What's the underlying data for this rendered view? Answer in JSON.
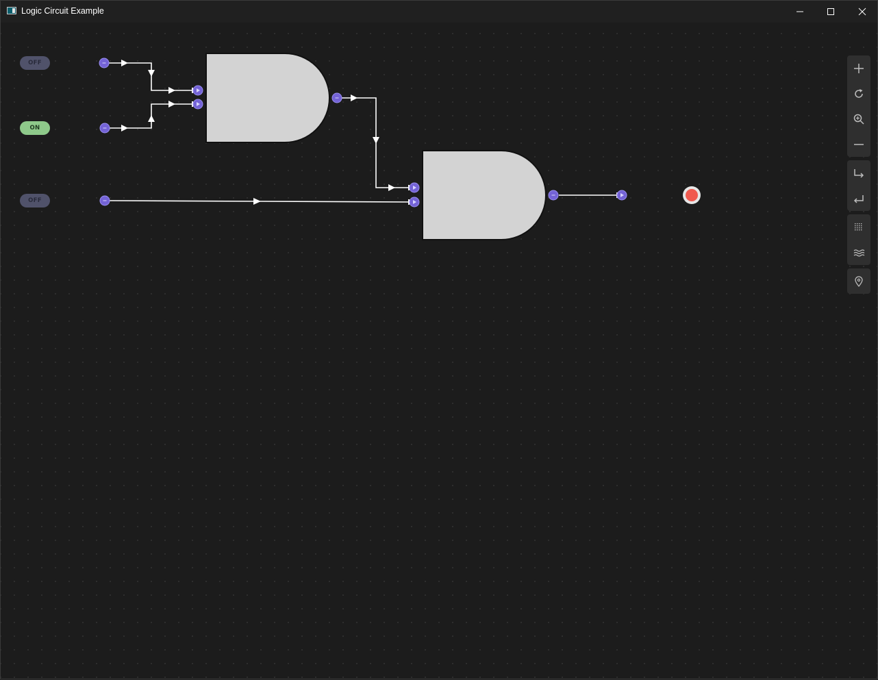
{
  "window": {
    "title": "Logic Circuit Example",
    "icons": [
      "app-icon",
      "minimize-icon",
      "maximize-icon",
      "close-icon"
    ]
  },
  "inputs": [
    {
      "label": "OFF",
      "state": "off"
    },
    {
      "label": "ON",
      "state": "on"
    },
    {
      "label": "OFF",
      "state": "off"
    }
  ],
  "gates": [
    {
      "type": "AND",
      "inputs": 2
    },
    {
      "type": "AND",
      "inputs": 2
    }
  ],
  "output": {
    "state": "off",
    "color": "#f05a4f"
  },
  "colors": {
    "toggle_off": "#50526a",
    "toggle_on": "#8ec98a",
    "handle": "#7463d6",
    "gate_fill": "#d3d3d3",
    "wire": "#ffffff"
  },
  "toolbar": {
    "groups": [
      [
        "plus-icon",
        "reset-icon",
        "zoom-in-icon",
        "zoom-out-icon"
      ],
      [
        "step-into-icon",
        "return-icon"
      ],
      [
        "grid-icon",
        "waves-icon"
      ],
      [
        "location-pin-icon"
      ]
    ]
  }
}
